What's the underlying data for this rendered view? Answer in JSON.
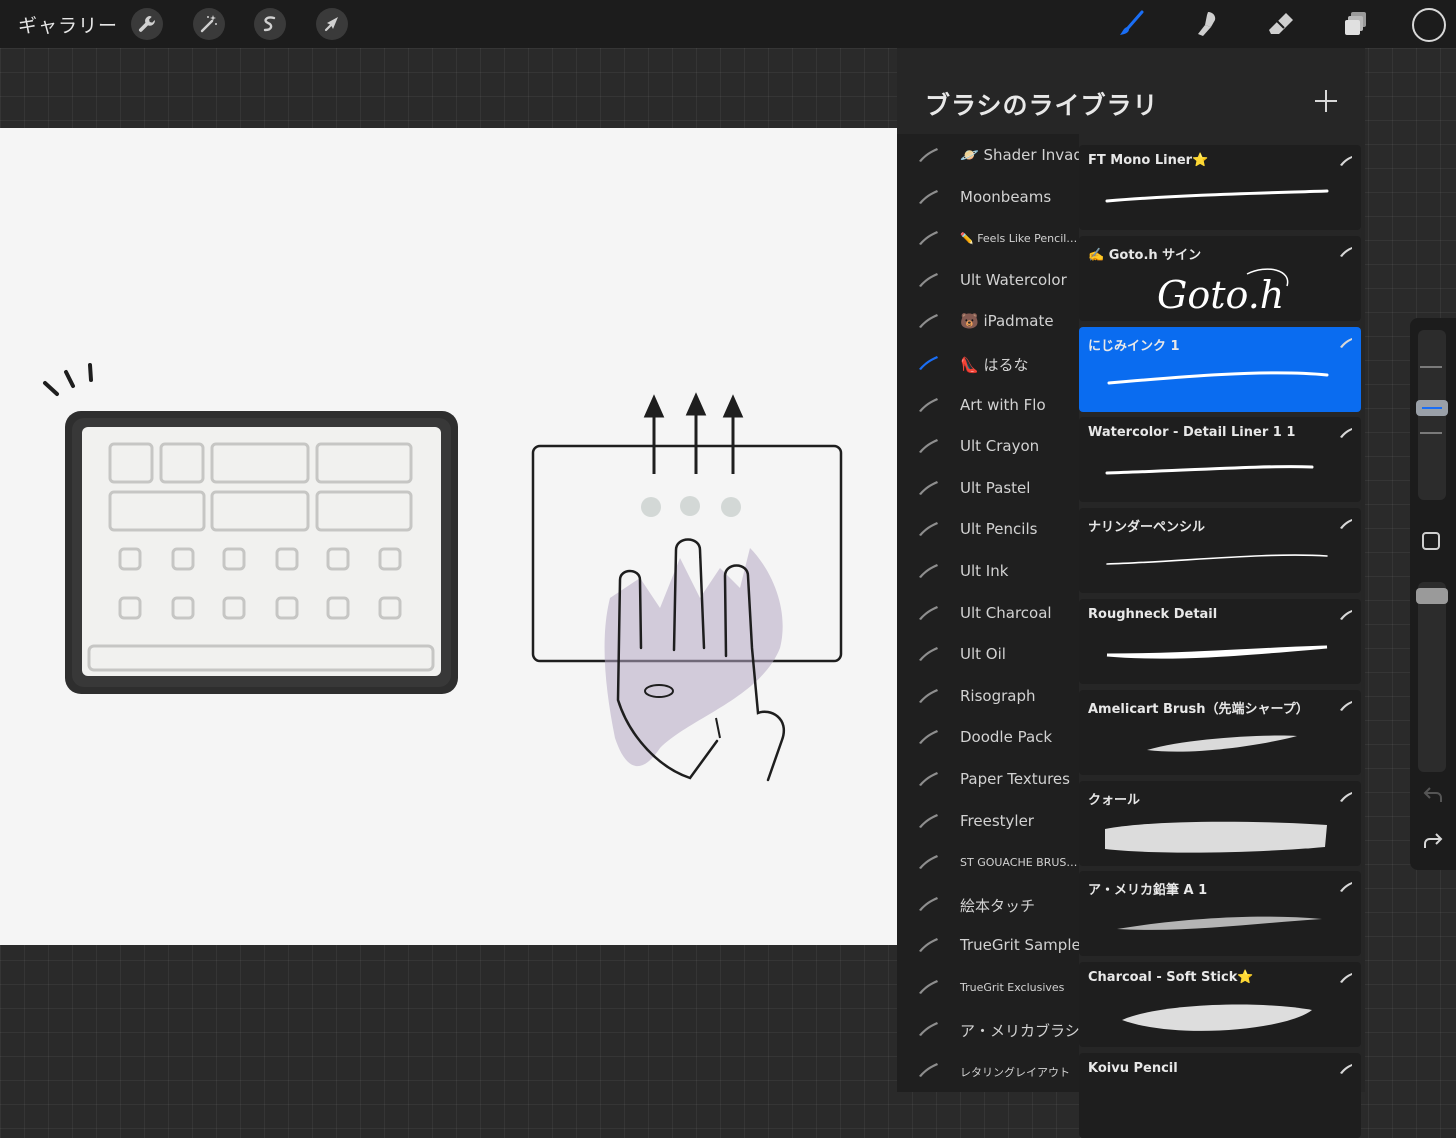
{
  "topbar": {
    "gallery_label": "ギャラリー",
    "tools": [
      "wrench-icon",
      "magic-wand-icon",
      "selection-icon",
      "transform-arrow-icon"
    ],
    "right_tools": [
      "brush-icon",
      "smudge-icon",
      "eraser-icon",
      "layers-icon",
      "color-icon"
    ],
    "accent": "#1a6ef5"
  },
  "panel": {
    "title": "ブラシのライブラリ",
    "add_icon": "plus-icon"
  },
  "brush_sets": [
    {
      "label": "🪐 Shader Invader"
    },
    {
      "label": "Moonbeams"
    },
    {
      "label": "✏️ Feels Like Pencil…"
    },
    {
      "label": "Ult Watercolor"
    },
    {
      "label": "🐻 iPadmate"
    },
    {
      "label": "👠 はるな"
    },
    {
      "label": "Art with Flo"
    },
    {
      "label": "Ult Crayon"
    },
    {
      "label": "Ult Pastel"
    },
    {
      "label": "Ult Pencils"
    },
    {
      "label": "Ult Ink"
    },
    {
      "label": "Ult Charcoal"
    },
    {
      "label": "Ult Oil"
    },
    {
      "label": "Risograph"
    },
    {
      "label": "Doodle Pack"
    },
    {
      "label": "Paper Textures"
    },
    {
      "label": "Freestyler"
    },
    {
      "label": "ST GOUACHE BRUS…"
    },
    {
      "label": "絵本タッチ"
    },
    {
      "label": "TrueGrit Sampler"
    },
    {
      "label": "TrueGrit Exclusives"
    },
    {
      "label": "ア・メリカブラシ"
    },
    {
      "label": "レタリングレイアウト"
    }
  ],
  "brushes": [
    {
      "name": "FT Mono Liner⭐"
    },
    {
      "name": "✍️ Goto.h サイン"
    },
    {
      "name": "にじみインク 1"
    },
    {
      "name": "Watercolor - Detail Liner 1 1"
    },
    {
      "name": "ナリンダーペンシル"
    },
    {
      "name": "Roughneck Detail"
    },
    {
      "name": "Amelicart Brush（先端シャープ）"
    },
    {
      "name": "クォール"
    },
    {
      "name": "ア・メリカ鉛筆 A 1"
    },
    {
      "name": "Charcoal - Soft Stick⭐"
    },
    {
      "name": "Koivu Pencil"
    }
  ],
  "selected_set_index": 5,
  "selected_brush_index": 2,
  "signature_text": "Goto.h",
  "sidebar": {
    "icons": [
      "modify-square-icon",
      "undo-icon",
      "redo-icon"
    ]
  }
}
